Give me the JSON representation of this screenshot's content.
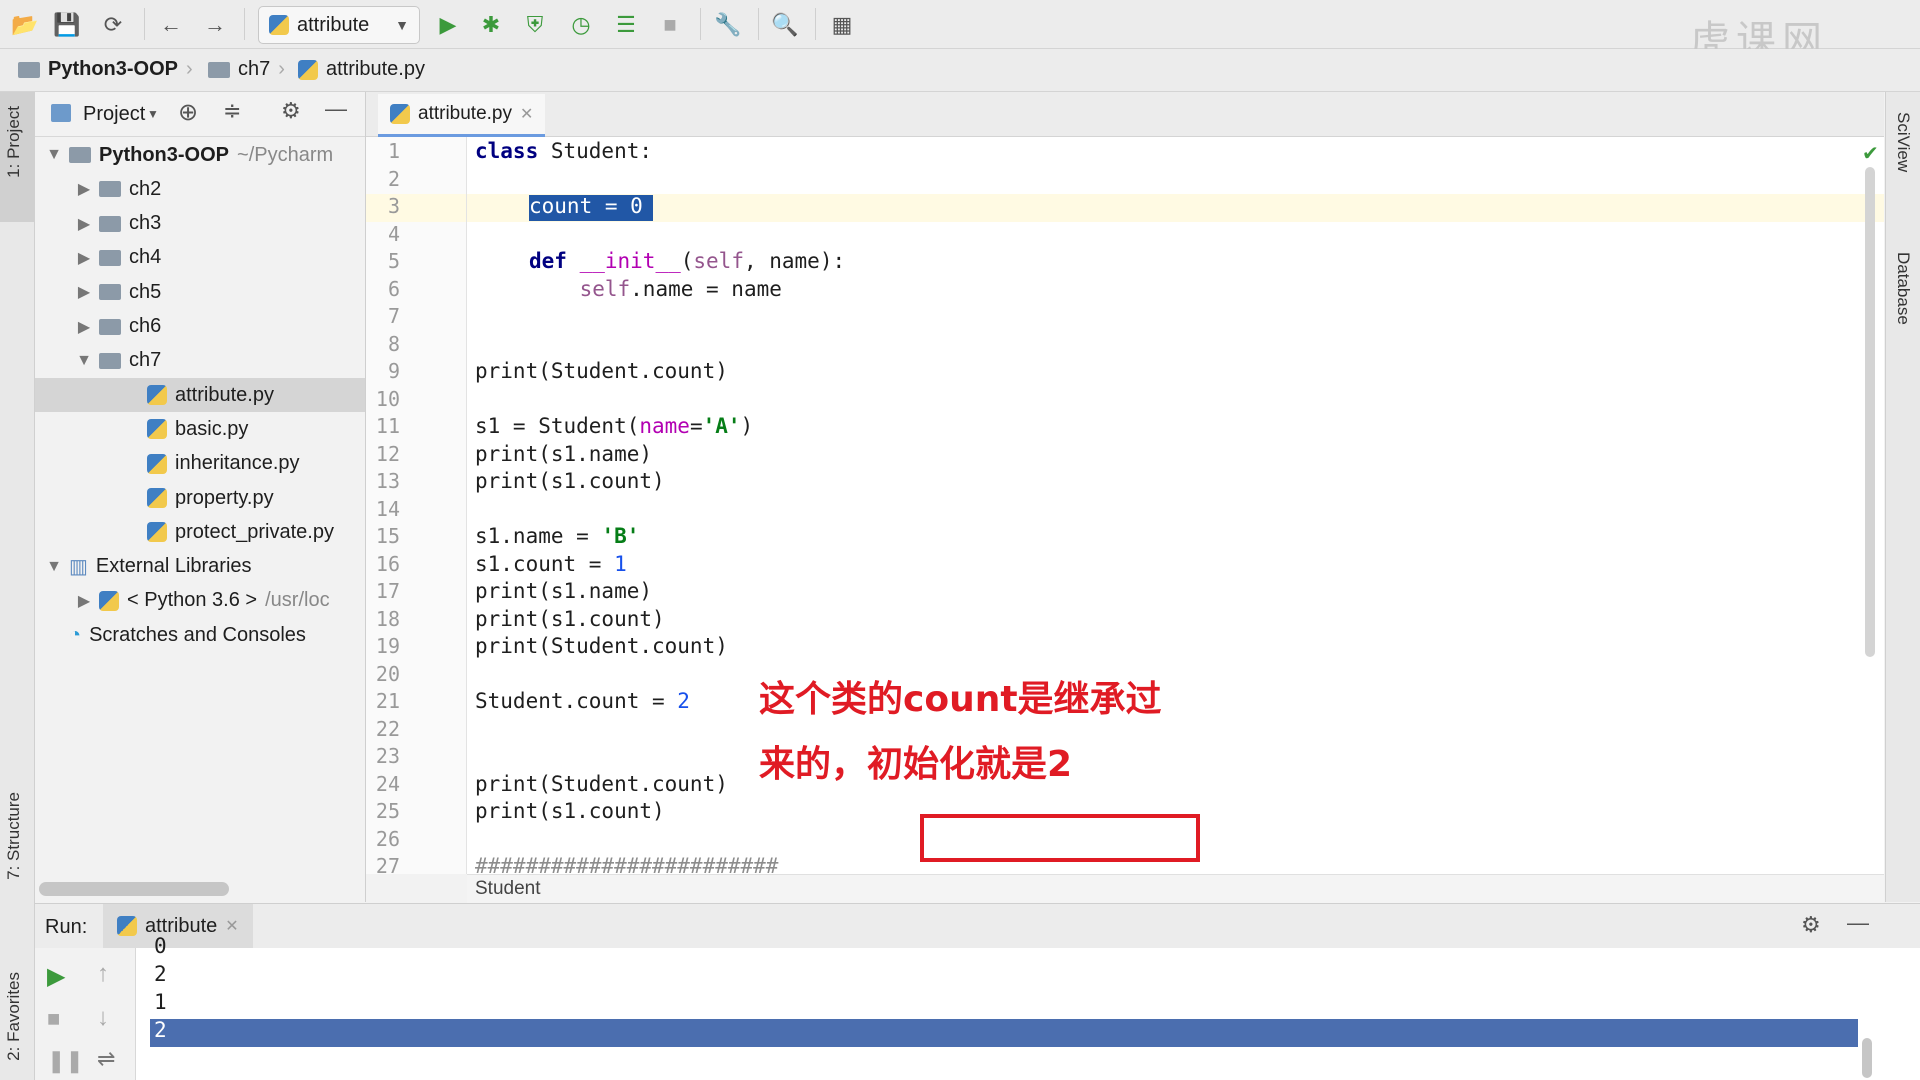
{
  "toolbar": {
    "run_config": "attribute",
    "icons": [
      "open-icon",
      "save-icon",
      "sync-icon",
      "back-icon",
      "forward-icon",
      "run-icon",
      "debug-icon",
      "coverage-icon",
      "profile-icon",
      "concurrency-icon",
      "stop-icon",
      "settings-wrench-icon",
      "search-icon",
      "structure-icon"
    ]
  },
  "breadcrumb": {
    "project": "Python3-OOP",
    "folder": "ch7",
    "file": "attribute.py"
  },
  "watermark": "虎课网",
  "left_strip": {
    "project_tab": "1: Project",
    "structure_tab": "7: Structure",
    "favorites_tab": "2: Favorites"
  },
  "right_strip": {
    "sciview_tab": "SciView",
    "database_tab": "Database"
  },
  "project_panel": {
    "title": "Project",
    "tree": [
      {
        "label": "Python3-OOP",
        "hint": "~/Pycharm",
        "kind": "root",
        "arrow": "▼"
      },
      {
        "label": "ch2",
        "kind": "folder",
        "arrow": "▶"
      },
      {
        "label": "ch3",
        "kind": "folder",
        "arrow": "▶"
      },
      {
        "label": "ch4",
        "kind": "folder",
        "arrow": "▶"
      },
      {
        "label": "ch5",
        "kind": "folder",
        "arrow": "▶"
      },
      {
        "label": "ch6",
        "kind": "folder",
        "arrow": "▶"
      },
      {
        "label": "ch7",
        "kind": "folder",
        "arrow": "▼"
      },
      {
        "label": "attribute.py",
        "kind": "file",
        "selected": true
      },
      {
        "label": "basic.py",
        "kind": "file"
      },
      {
        "label": "inheritance.py",
        "kind": "file"
      },
      {
        "label": "property.py",
        "kind": "file"
      },
      {
        "label": "protect_private.py",
        "kind": "file"
      },
      {
        "label": "External Libraries",
        "kind": "lib",
        "arrow": "▼"
      },
      {
        "label": "< Python 3.6 >",
        "hint": "/usr/loc",
        "kind": "python",
        "arrow": "▶"
      },
      {
        "label": "Scratches and Consoles",
        "kind": "scratch"
      }
    ]
  },
  "editor": {
    "tab_label": "attribute.py",
    "line_numbers": [
      "1",
      "2",
      "3",
      "4",
      "5",
      "6",
      "7",
      "8",
      "9",
      "10",
      "11",
      "12",
      "13",
      "14",
      "15",
      "16",
      "17",
      "18",
      "19",
      "20",
      "21",
      "22",
      "23",
      "24",
      "25",
      "26",
      "27"
    ],
    "lines": {
      "l1_kw": "class",
      "l1_rest": " Student:",
      "l3_sel": "count = 0",
      "l5_kw": "def",
      "l5_fn": " __init__",
      "l5_a": "(",
      "l5_self": "self",
      "l5_b": ", name):",
      "l6_self": "    self",
      "l6_rest": ".name = name",
      "l9": "print(Student.count)",
      "l11_a": "s1 = Student(",
      "l11_param": "name",
      "l11_eq": "=",
      "l11_str": "'A'",
      "l11_end": ")",
      "l12": "print(s1.name)",
      "l13": "print(s1.count)",
      "l15_a": "s1.name = ",
      "l15_str": "'B'",
      "l16_a": "s1.count = ",
      "l16_num": "1",
      "l17": "print(s1.name)",
      "l18": "print(s1.count)",
      "l19": "print(Student.count)",
      "l21_a": "Student.count = ",
      "l21_num": "2",
      "l24": "print(Student.count)",
      "l25": "print(s1.count)",
      "l27": "########################"
    },
    "annotation_line1": "这个类的count是继承过",
    "annotation_line2": "来的，初始化就是2",
    "status_context": "Student"
  },
  "run_panel": {
    "label": "Run:",
    "tab": "attribute",
    "output": [
      "0",
      "2",
      "1",
      "2"
    ],
    "selected_index": 3
  }
}
